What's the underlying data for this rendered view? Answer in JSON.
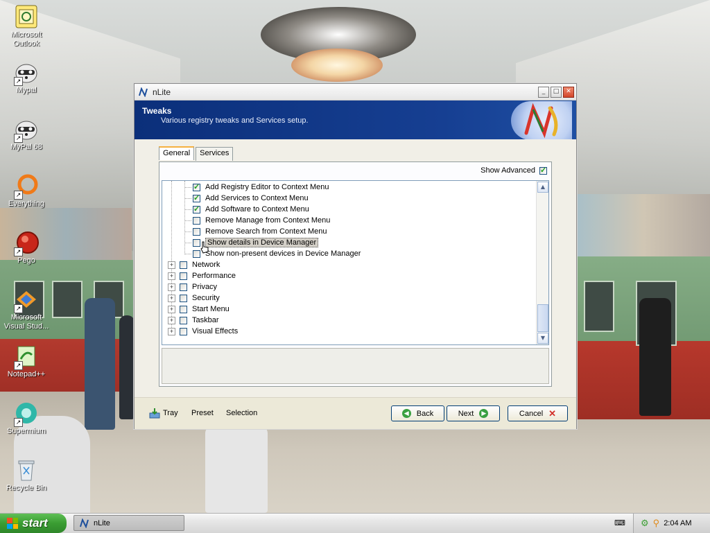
{
  "desktop": {
    "icons": [
      {
        "label": "Microsoft Outlook"
      },
      {
        "label": "Mypal"
      },
      {
        "label": "MyPal 68"
      },
      {
        "label": "Everything"
      },
      {
        "label": "Pego"
      },
      {
        "label": "Microsoft Visual Stud..."
      },
      {
        "label": "Notepad++"
      },
      {
        "label": "Supermium"
      },
      {
        "label": "Recycle Bin"
      }
    ]
  },
  "window": {
    "title": "nLite",
    "header": {
      "title": "Tweaks",
      "subtitle": "Various registry tweaks and Services setup."
    },
    "tabs": [
      {
        "label": "General",
        "active": true
      },
      {
        "label": "Services",
        "active": false
      }
    ],
    "show_advanced": {
      "label": "Show Advanced",
      "checked": true
    },
    "tree": {
      "children": [
        {
          "label": "Add Registry Editor to Context Menu",
          "checked": true
        },
        {
          "label": "Add Services to Context Menu",
          "checked": true
        },
        {
          "label": "Add Software to Context Menu",
          "checked": true
        },
        {
          "label": "Remove Manage from Context Menu",
          "checked": false
        },
        {
          "label": "Remove Search from Context Menu",
          "checked": false
        },
        {
          "label": "Show details in Device Manager",
          "checked": false,
          "selected": true
        },
        {
          "label": "Show non-present devices in Device Manager",
          "checked": false
        }
      ],
      "groups": [
        {
          "label": "Network"
        },
        {
          "label": "Performance"
        },
        {
          "label": "Privacy"
        },
        {
          "label": "Security"
        },
        {
          "label": "Start Menu"
        },
        {
          "label": "Taskbar"
        },
        {
          "label": "Visual Effects"
        }
      ]
    },
    "footer": {
      "tray": "Tray",
      "preset": "Preset",
      "selection": "Selection",
      "back": "Back",
      "next": "Next",
      "cancel": "Cancel"
    }
  },
  "taskbar": {
    "start_label": "start",
    "task_label": "nLite",
    "clock": "2:04 AM"
  },
  "colors": {
    "header_bg": "#163f92",
    "start_green": "#3a9d32",
    "check_green": "#21a121"
  }
}
